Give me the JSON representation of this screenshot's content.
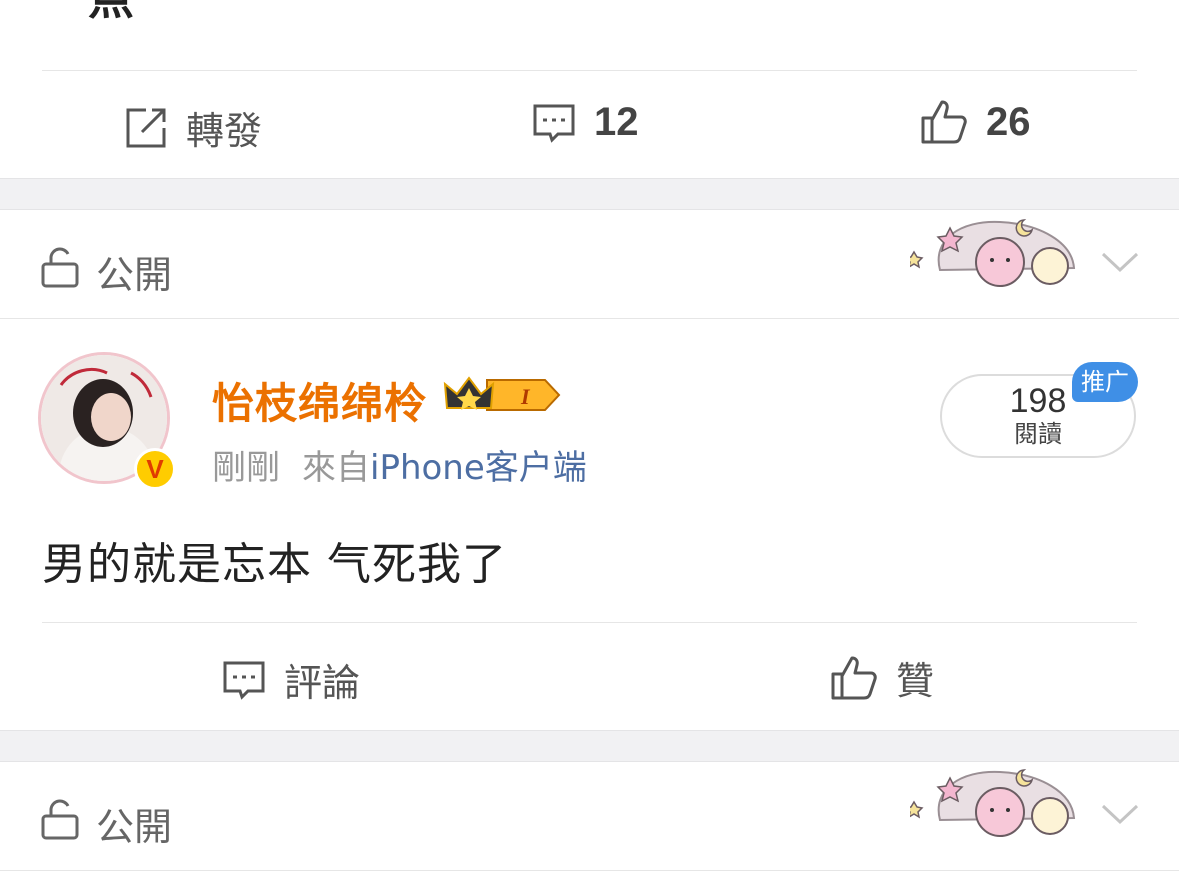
{
  "previous_post": {
    "text_fragment": "一点",
    "actions": {
      "repost_label": "轉發",
      "comment_count": "12",
      "like_count": "26"
    }
  },
  "post_header": {
    "visibility_label": "公開",
    "sticker_icon": "pink-clouds-sticker"
  },
  "post": {
    "username": "怡枝绵绵柃",
    "member_badge": "I",
    "time": "剛剛",
    "source_prefix": "來自",
    "source_name": "iPhone客户端",
    "reads_count": "198",
    "reads_label": "閱讀",
    "promo_label": "推广",
    "content": "男的就是忘本 气死我了",
    "actions": {
      "comment_label": "評論",
      "like_label": "贊"
    }
  },
  "next_post_header": {
    "visibility_label": "公開"
  },
  "colors": {
    "username": "#eb7100",
    "source": "#4d6ea3",
    "promo": "#3f8fe6",
    "gap": "#f1f1f3"
  }
}
